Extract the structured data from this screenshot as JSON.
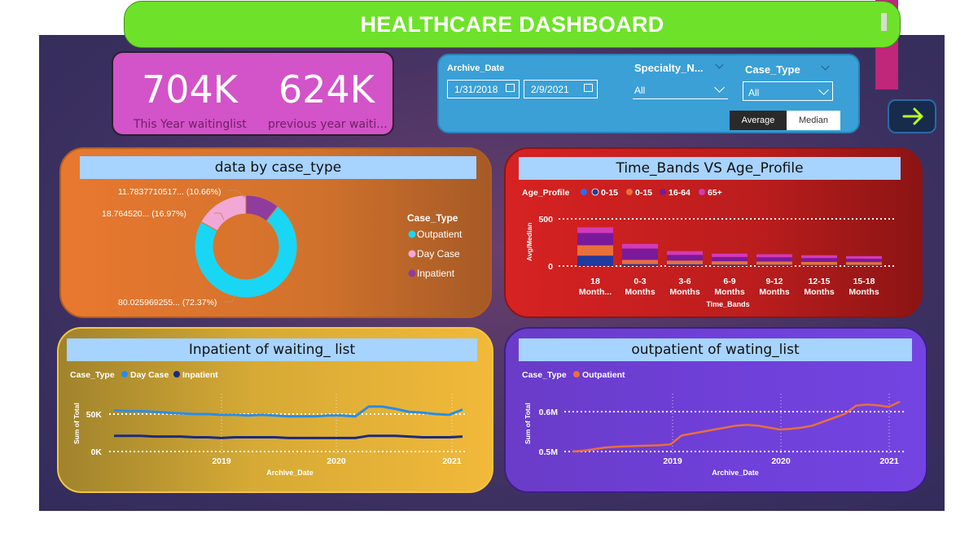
{
  "header": {
    "title": "HEALTHCARE DASHBOARD"
  },
  "kpis": [
    {
      "value": "704K",
      "label": "This Year waitinglist"
    },
    {
      "value": "624K",
      "label": "previous year waiti..."
    }
  ],
  "slicers": {
    "archive_date": {
      "title": "Archive_Date",
      "start": "1/31/2018",
      "end": "2/9/2021"
    },
    "specialty": {
      "title": "Specialty_N...",
      "value": "All"
    },
    "case_type": {
      "title": "Case_Type",
      "value": "All"
    },
    "toggle": {
      "average": "Average",
      "median": "Median",
      "selected": "Average"
    }
  },
  "nav": {
    "icon": "arrow-right-icon"
  },
  "colors": {
    "title_bar": "#6ee22a",
    "kpi_card": "#d353c8",
    "slicer_card": "#3aa0d6",
    "outpatient": "#1ad6f5",
    "day_case": "#f2a8d6",
    "inpatient": "#8e3c9e",
    "age_c1": "#1f3aa0",
    "age_c2": "#e8703a",
    "age_c3": "#7a1a9a",
    "age_c4": "#d23ab8"
  },
  "panels": {
    "case_type": {
      "title": "data by case_type",
      "legend_title": "Case_Type",
      "slice_labels": [
        "80.025969255... (72.37%)",
        "18.764520... (16.97%)",
        "11.7837710517... (10.66%)"
      ]
    },
    "time_bands": {
      "title": "Time_Bands VS Age_Profile",
      "legend_title": "Age_Profile",
      "legend": [
        "0-15",
        "0-15",
        "16-64",
        "65+"
      ],
      "ylabel": "Avg/Median",
      "xlabel": "Time_Bands",
      "ytick_labels": [
        "0",
        "500"
      ]
    },
    "inpatient": {
      "title": "Inpatient of waiting_ list",
      "legend_title": "Case_Type",
      "legend": [
        "Day Case",
        "Inpatient"
      ],
      "ylabel": "Sum of Total",
      "xlabel": "Archive_Date",
      "ytick_labels": [
        "0K",
        "50K"
      ],
      "xtick_labels": [
        "2019",
        "2020",
        "2021"
      ]
    },
    "outpatient": {
      "title": "outpatient of wating_list",
      "legend_title": "Case_Type",
      "legend": [
        "Outpatient"
      ],
      "ylabel": "Sum of Total",
      "xlabel": "Archive_Date",
      "ytick_labels": [
        "0.5M",
        "0.6M"
      ],
      "xtick_labels": [
        "2019",
        "2020",
        "2021"
      ]
    }
  },
  "chart_data": [
    {
      "type": "pie",
      "title": "data by case_type",
      "labels": [
        "Outpatient",
        "Day Case",
        "Inpatient"
      ],
      "values": [
        80.03,
        18.76,
        11.78
      ],
      "percentages": [
        72.37,
        16.97,
        10.66
      ]
    },
    {
      "type": "bar",
      "stacked": true,
      "title": "Time_Bands VS Age_Profile",
      "categories": [
        "18 Month...",
        "0-3 Months",
        "3-6 Months",
        "6-9 Months",
        "9-12 Months",
        "12-15 Months",
        "15-18 Months"
      ],
      "category_lines": [
        [
          "18",
          "Month..."
        ],
        [
          "0-3",
          "Months"
        ],
        [
          "3-6",
          "Months"
        ],
        [
          "6-9",
          "Months"
        ],
        [
          "9-12",
          "Months"
        ],
        [
          "12-15",
          "Months"
        ],
        [
          "15-18",
          "Months"
        ]
      ],
      "series": [
        {
          "name": "0-15",
          "values": [
            110,
            20,
            18,
            15,
            14,
            12,
            12
          ]
        },
        {
          "name": "0-15",
          "values": [
            110,
            45,
            40,
            36,
            34,
            32,
            30
          ]
        },
        {
          "name": "16-64",
          "values": [
            130,
            120,
            60,
            45,
            45,
            40,
            35
          ]
        },
        {
          "name": "65+",
          "values": [
            60,
            50,
            40,
            35,
            32,
            30,
            28
          ]
        }
      ],
      "ylabel": "Avg/Median",
      "xlabel": "Time_Bands",
      "ylim": [
        0,
        500
      ]
    },
    {
      "type": "line",
      "title": "Inpatient of waiting_ list",
      "x_start": 2018.08,
      "x_end": 2021.1,
      "xlim": [
        2018.08,
        2021.1
      ],
      "ylim": [
        0,
        50
      ],
      "y_unit": "K",
      "series": [
        {
          "name": "Day Case",
          "values": [
            55,
            54,
            54,
            53,
            52,
            51,
            50,
            50,
            49,
            49,
            48,
            49,
            48,
            47,
            47,
            47,
            48,
            48,
            47,
            60,
            60,
            57,
            53,
            52,
            50,
            49,
            56
          ]
        },
        {
          "name": "Inpatient",
          "values": [
            21,
            21,
            21,
            20,
            20,
            20,
            19,
            19,
            18,
            19,
            19,
            19,
            19,
            18,
            18,
            18,
            18,
            18,
            18,
            21,
            21,
            21,
            20,
            19,
            19,
            19,
            20
          ]
        }
      ],
      "ylabel": "Sum of Total",
      "xlabel": "Archive_Date"
    },
    {
      "type": "line",
      "title": "outpatient of wating_list",
      "x_start": 2018.08,
      "x_end": 2021.1,
      "xlim": [
        2018.08,
        2021.1
      ],
      "ylim": [
        0.5,
        0.6
      ],
      "y_unit": "M",
      "series": [
        {
          "name": "Outpatient",
          "values": [
            0.5,
            0.502,
            0.506,
            0.51,
            0.512,
            0.513,
            0.514,
            0.515,
            0.516,
            0.518,
            0.54,
            0.545,
            0.55,
            0.555,
            0.56,
            0.565,
            0.567,
            0.565,
            0.56,
            0.555,
            0.557,
            0.56,
            0.565,
            0.575,
            0.585,
            0.595,
            0.615,
            0.618,
            0.616,
            0.612,
            0.625
          ]
        }
      ],
      "ylabel": "Sum of Total",
      "xlabel": "Archive_Date"
    }
  ]
}
